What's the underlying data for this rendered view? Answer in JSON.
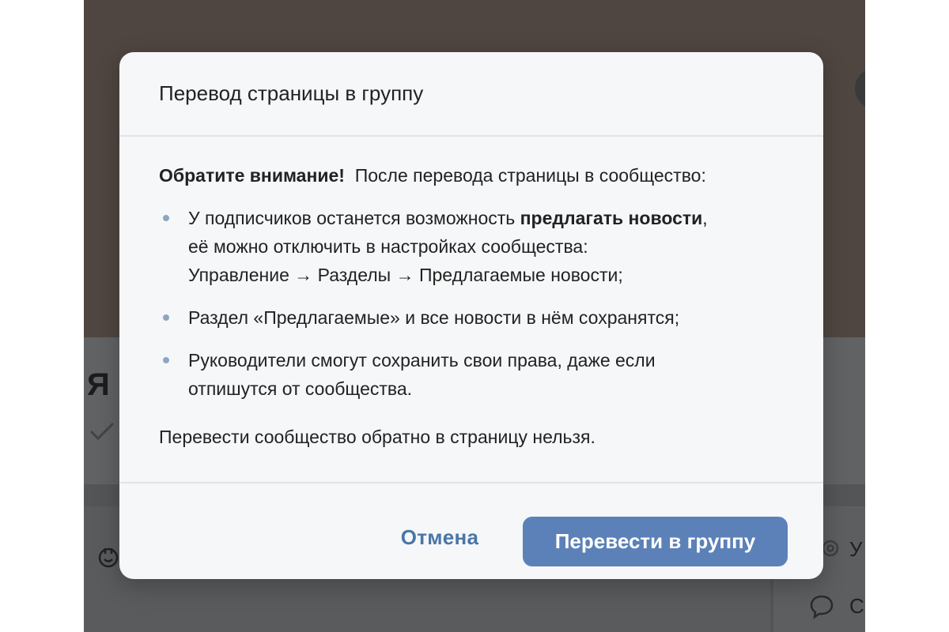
{
  "background": {
    "name_fragment": "Я",
    "right_text_top": "У",
    "right_text_bottom": "С"
  },
  "modal": {
    "title": "Перевод страницы в группу",
    "intro_bold": "Обратите внимание!",
    "intro_rest": "После перевода страницы в сообщество:",
    "bullets": [
      {
        "text_before": "У подписчиков останется возможность ",
        "bold": "предлагать новости",
        "text_after": ",",
        "line2": "её можно отключить в настройках сообщества:",
        "line3": "Управление → Разделы → Предлагаемые новости;"
      },
      {
        "text": "Раздел «Предлагаемые» и все новости в нём сохранятся;"
      },
      {
        "line1": "Руководители смогут сохранить свои права, даже если",
        "line2": "отпишутся от сообщества."
      }
    ],
    "footnote": "Перевести сообщество обратно в страницу нельзя.",
    "cancel_label": "Отмена",
    "confirm_label": "Перевести в группу"
  },
  "colors": {
    "accent": "#5b81b8",
    "link": "#4a76a8",
    "bullet_dot": "#8ea6c2"
  }
}
